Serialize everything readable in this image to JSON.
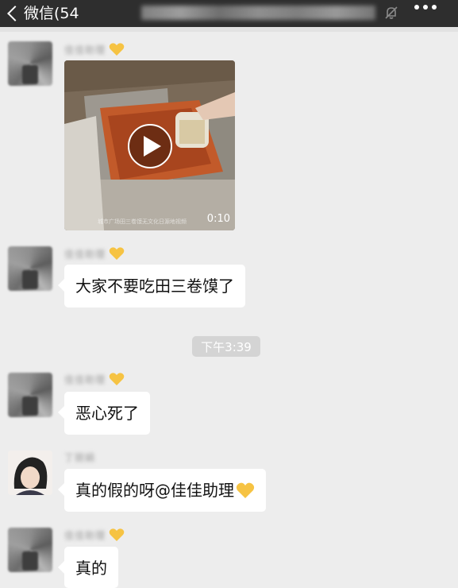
{
  "navbar": {
    "back_label": "微信(54",
    "title": "",
    "icons": {
      "back": "chevron-left-icon",
      "mute": "mute-bell-icon",
      "more": "more-dots-icon"
    }
  },
  "messages": [
    {
      "id": "m1",
      "sender_name": "佳佳助理",
      "type": "video",
      "video_duration": "0:10",
      "video_watermark": "城市广场田三卷馍无文化日源地视频"
    },
    {
      "id": "m2",
      "sender_name": "佳佳助理",
      "type": "text",
      "text": "大家不要吃田三卷馍了"
    },
    {
      "id": "m3",
      "sender_name": "佳佳助理",
      "type": "text",
      "text": "恶心死了"
    },
    {
      "id": "m4",
      "sender_name": "丁丽娟",
      "type": "text",
      "text": "真的假的呀@佳佳助理",
      "emoji": "yellow-heart"
    },
    {
      "id": "m5",
      "sender_name": "佳佳助理",
      "type": "text",
      "text": "真的"
    }
  ],
  "timestamp": "下午3:39",
  "colors": {
    "navbar_bg": "#2e2e2e",
    "chat_bg": "#ededed",
    "bubble_bg": "#ffffff",
    "heart_yellow": "#f6c343"
  }
}
